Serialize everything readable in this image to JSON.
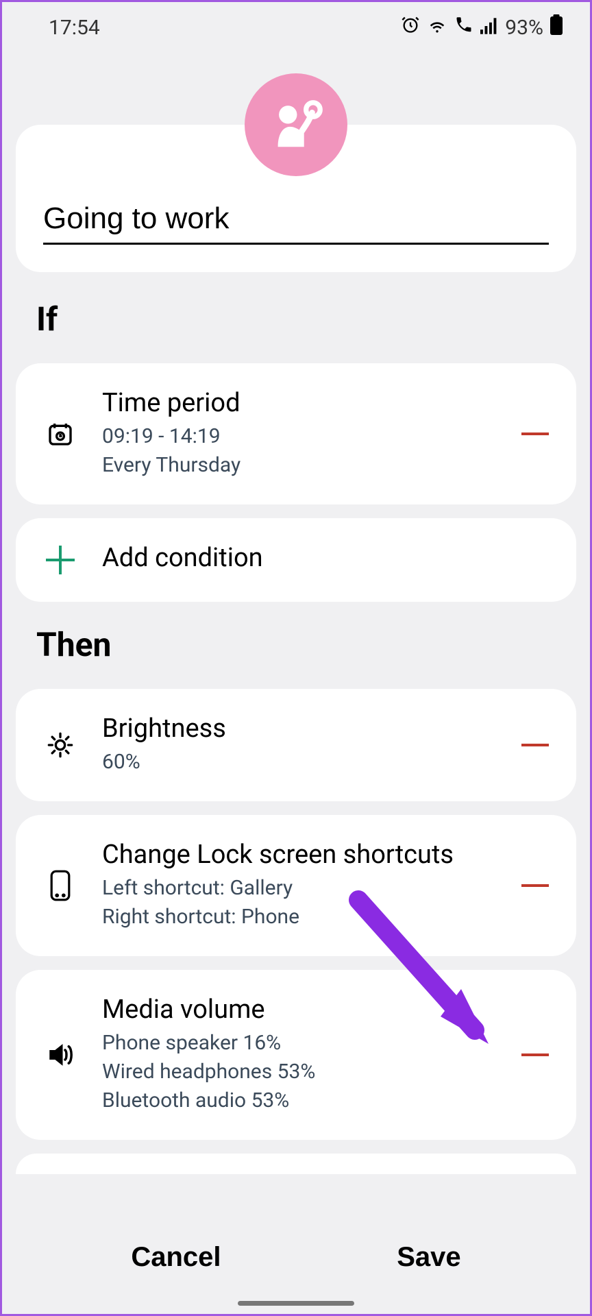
{
  "status": {
    "time": "17:54",
    "battery": "93%"
  },
  "title": "Going to work",
  "sections": {
    "if_label": "If",
    "then_label": "Then"
  },
  "if_items": [
    {
      "title": "Time period",
      "sub1": "09:19 - 14:19",
      "sub2": "Every Thursday"
    }
  ],
  "add_condition_label": "Add condition",
  "then_items": [
    {
      "title": "Brightness",
      "sub1": "60%"
    },
    {
      "title": "Change Lock screen shortcuts",
      "sub1": "Left shortcut: Gallery",
      "sub2": "Right shortcut: Phone"
    },
    {
      "title": "Media volume",
      "sub1": "Phone speaker 16%",
      "sub2": "Wired headphones 53%",
      "sub3": "Bluetooth audio 53%"
    }
  ],
  "buttons": {
    "cancel": "Cancel",
    "save": "Save"
  }
}
